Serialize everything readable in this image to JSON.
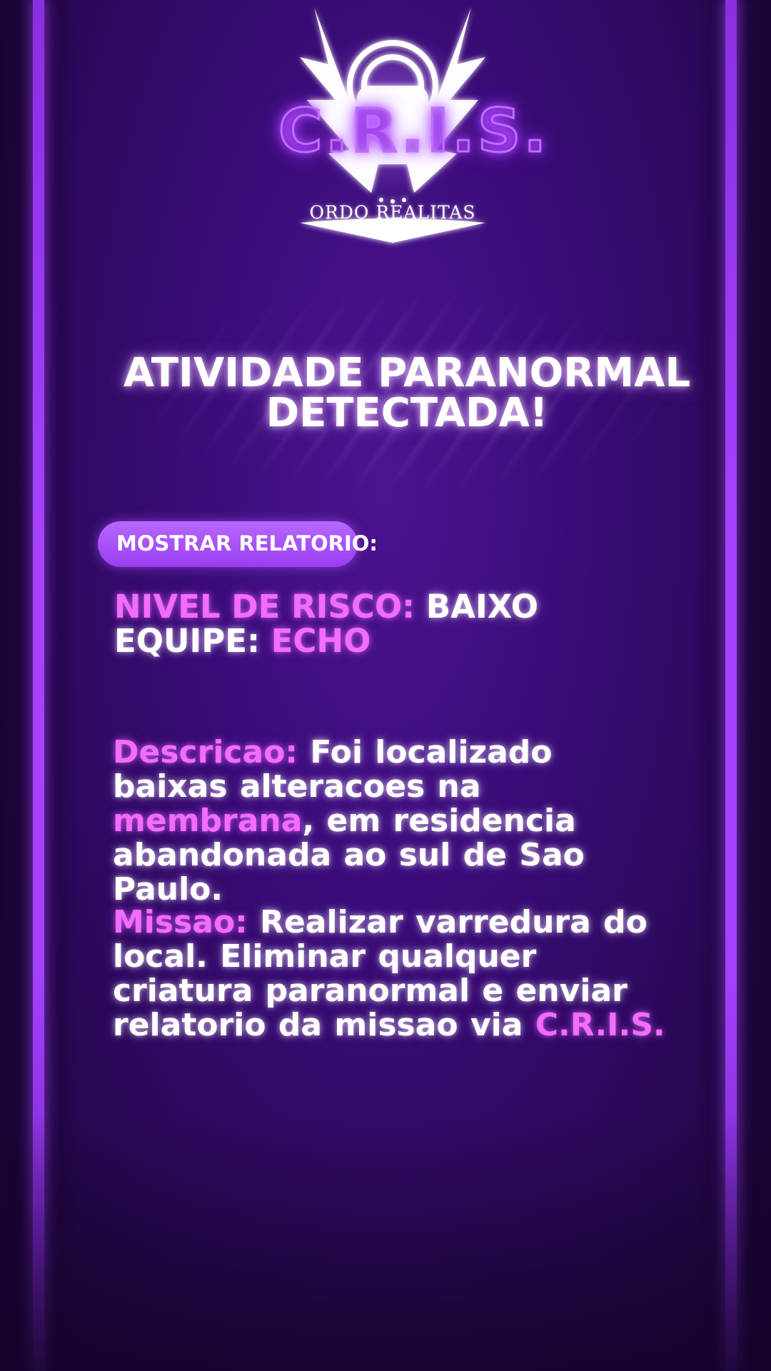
{
  "logo": {
    "acronym": "C.R.I.S.",
    "organization": "ORDO REALITAS"
  },
  "alert": {
    "line1": "ATIVIDADE PARANORMAL",
    "line2": "DETECTADA!"
  },
  "report_button": {
    "label": "MOSTRAR RELATORIO:"
  },
  "stats": {
    "risk_label": "NIVEL DE RISCO:",
    "risk_value": " BAIXO",
    "team_label": "EQUIPE:",
    "team_value": " ECHO"
  },
  "description": {
    "label": "Descricao:",
    "text_before": " Foi localizado baixas alteracoes na ",
    "highlight": "membrana",
    "text_after": ", em residencia abandonada ao sul de Sao Paulo."
  },
  "mission": {
    "label": "Missao:",
    "text": " Realizar varredura do local. Eliminar qualquer criatura paranormal e enviar relatorio da missao via ",
    "highlight": "C.R.I.S."
  },
  "colors": {
    "background": "#3a0c78",
    "rail": "#a542ff",
    "accent_pink": "#f26cff",
    "button": "#a84cf8",
    "text": "#ffffff"
  }
}
